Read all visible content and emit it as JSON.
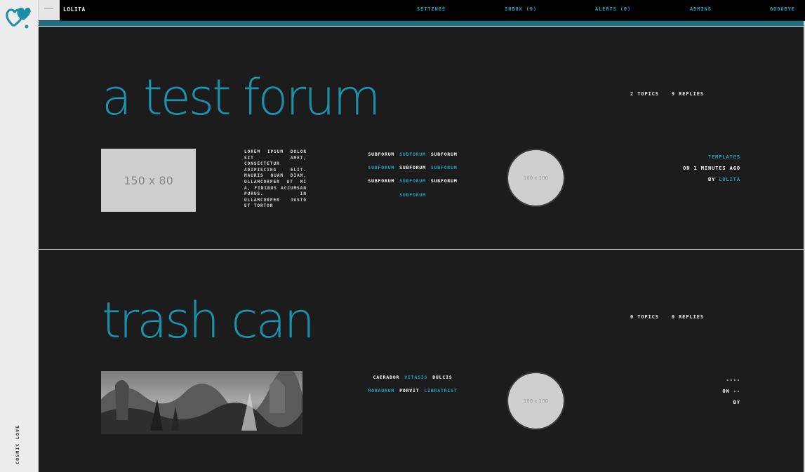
{
  "sidebar": {
    "vertical_text": "COSMIC LOVE"
  },
  "topbar": {
    "username": "LOLITA",
    "links": [
      "SETTINGS",
      "INBOX (0)",
      "ALERTS (0)",
      "ADMINS",
      "GOODBYE"
    ]
  },
  "forums": [
    {
      "title": "a test forum",
      "topics": "2 TOPICS",
      "replies": "9 REPLIES",
      "banner_placeholder": "150 x 80",
      "description": "LOREM IPSUM DOLOR SIT AMET, CONSECTETUR ADIPISCING ELIT. MAURIS QUAM DIAM, ULLAMCORPER UT MI A, FINIBUS ACCUMSAN PURUS. IN ULLAMCORPER JUSTO ET TORTOR",
      "subforums": [
        "SUBFORUM",
        "SUBFORUM",
        "SUBFORUM",
        "SUBFORUM",
        "SUBFORUM",
        "SUBFORUM",
        "SUBFORUM",
        "SUBFORUM",
        "SUBFORUM",
        "SUBFORUM"
      ],
      "circle_placeholder": "100 x 100",
      "last_post_topic": "TEMPLATES",
      "last_post_time": "ON 1 MINUTES AGO",
      "last_post_by": "BY",
      "last_post_author": "LOLITA"
    },
    {
      "title": "trash can",
      "topics": "0 TOPICS",
      "replies": "0 REPLIES",
      "subforums": [
        "CAERADOR",
        "VITASIS",
        "DULCIS",
        "MORAURUM",
        "PORVIT",
        "LIBRATRIST"
      ],
      "circle_placeholder": "100 x 100",
      "last_post_topic": "----",
      "last_post_time": "ON --",
      "last_post_by": "BY"
    }
  ],
  "colors": {
    "accent": "#1ea5c4",
    "title": "#1a92ad",
    "background": "#1c1c1c",
    "sidebar": "#ececec",
    "strip": "#1b6f7f"
  },
  "icons": {
    "logo": "teal-hearts-logo-icon"
  }
}
